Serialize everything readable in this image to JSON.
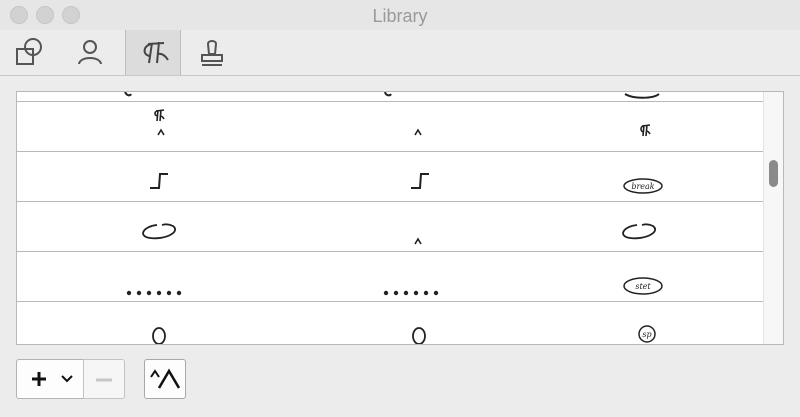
{
  "window": {
    "title": "Library"
  },
  "toolbar": {
    "tabs": [
      {
        "icon": "shapes-icon",
        "selected": false
      },
      {
        "icon": "person-icon",
        "selected": false
      },
      {
        "icon": "paragraph-icon",
        "selected": true
      },
      {
        "icon": "stamp-icon",
        "selected": false
      }
    ]
  },
  "library": {
    "rows": [
      {
        "cells": [
          "partial-mark",
          "partial-mark",
          "partial-ellipse"
        ]
      },
      {
        "cells": [
          "paragraph-caret-mark",
          "caret-mark",
          "paragraph-mark"
        ]
      },
      {
        "cells": [
          "step-line-mark",
          "step-line-mark",
          "break-stamp"
        ]
      },
      {
        "cells": [
          "open-ellipse-mark",
          "caret-mark",
          "open-ellipse-mark"
        ]
      },
      {
        "cells": [
          "dots-mark",
          "dots-mark",
          "stet-stamp"
        ]
      },
      {
        "cells": [
          "circle-mark",
          "circle-mark",
          "sp-stamp"
        ]
      }
    ],
    "stamp_text": {
      "break": "break",
      "stet": "stet",
      "sp": "sp"
    }
  },
  "bottom": {
    "add_icon": "plus-icon",
    "add_menu_icon": "chevron-down-icon",
    "remove_icon": "minus-icon",
    "shape_icon": "caret-peaks-icon"
  }
}
